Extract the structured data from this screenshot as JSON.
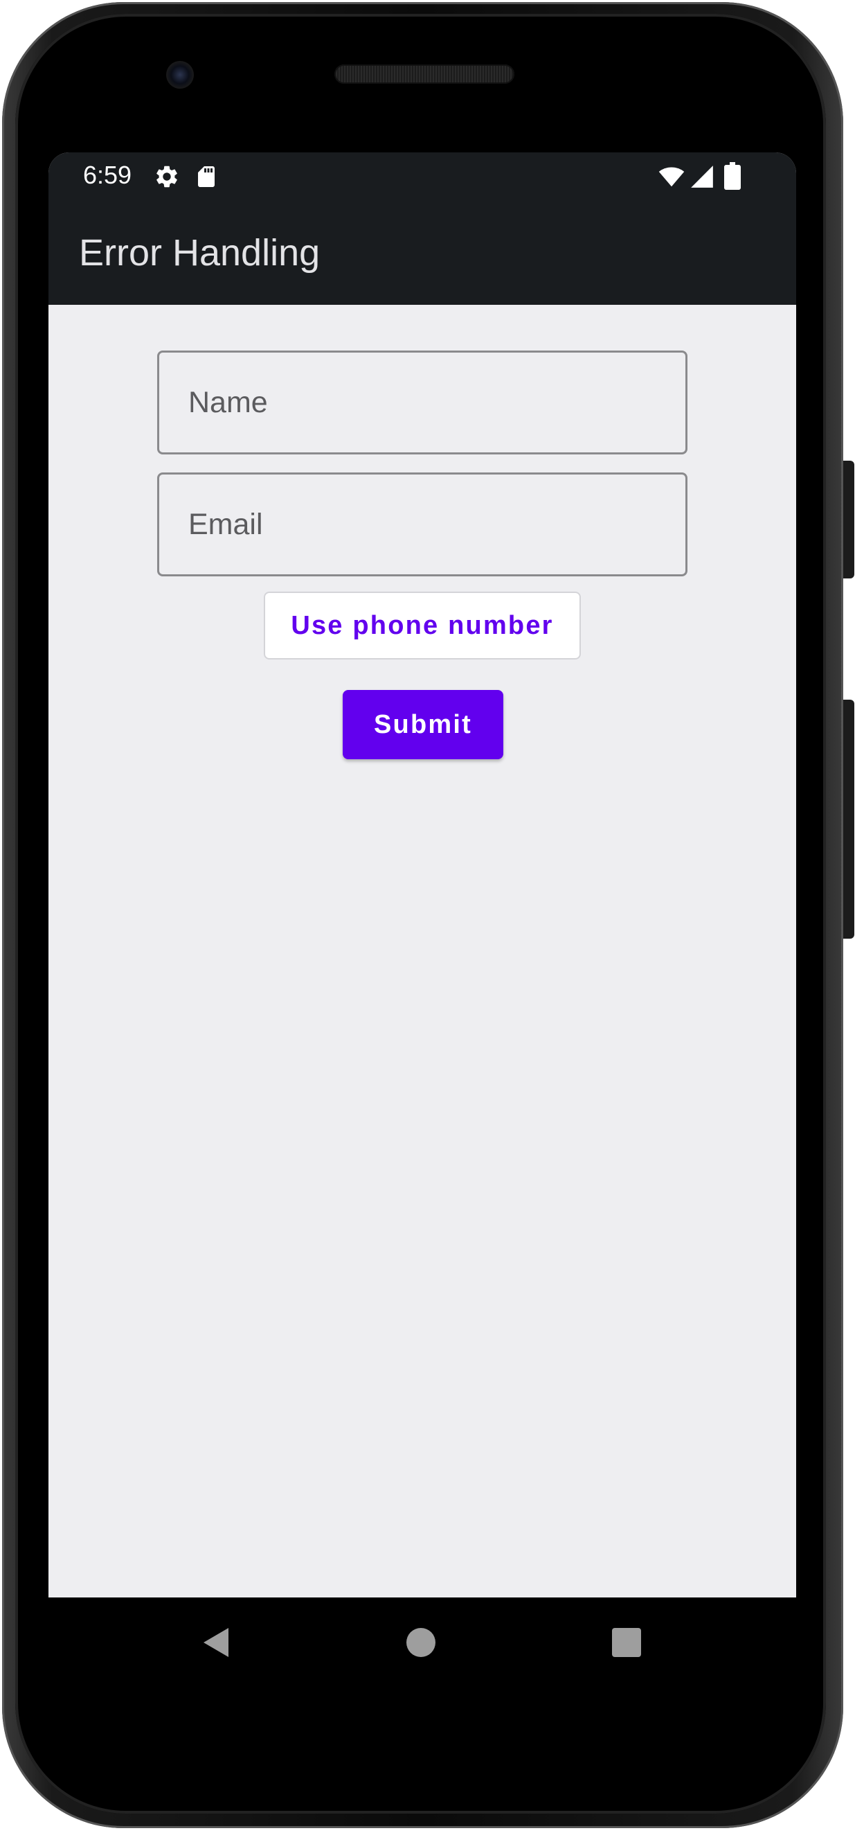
{
  "status_bar": {
    "time": "6:59",
    "left_icons": [
      "gear-icon",
      "sd-card-icon"
    ],
    "right_icons": [
      "wifi-icon",
      "cell-signal-icon",
      "battery-icon"
    ]
  },
  "app_bar": {
    "title": "Error Handling"
  },
  "form": {
    "name_placeholder": "Name",
    "name_value": "",
    "email_placeholder": "Email",
    "email_value": "",
    "phone_button_label": "Use phone number",
    "submit_button_label": "Submit"
  },
  "navigation": {
    "buttons": [
      "back-icon",
      "home-icon",
      "recents-icon"
    ]
  },
  "colors": {
    "primary": "#6200ee",
    "app_bar_background": "#191c1f",
    "content_background": "#eeeef1"
  }
}
